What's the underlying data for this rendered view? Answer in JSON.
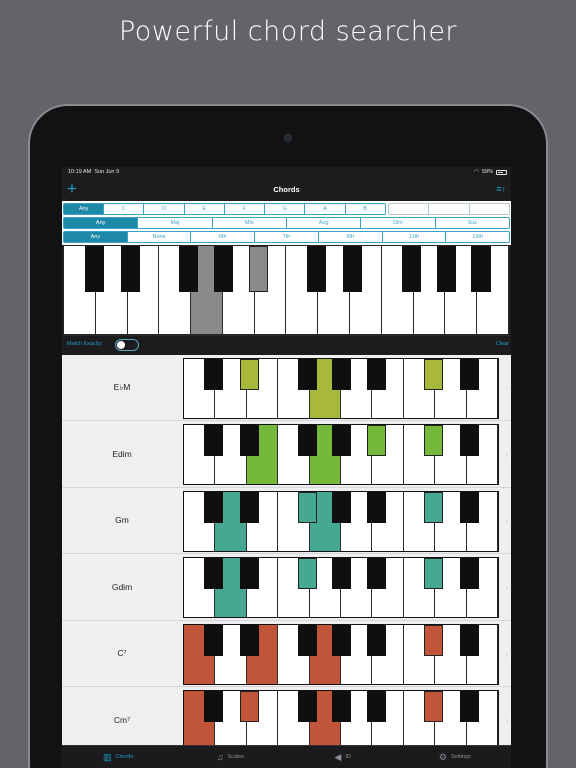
{
  "headline": "Powerful chord searcher",
  "status": {
    "time": "10:19 AM",
    "date": "Sun Jun 9",
    "battery": "59%"
  },
  "nav": {
    "title": "Chords",
    "add_icon": "plus-icon",
    "sort_icon": "sort-icon"
  },
  "filters": {
    "roots": [
      "Any",
      "C",
      "D",
      "E",
      "F",
      "G",
      "A",
      "B"
    ],
    "accidentals": [
      "",
      "",
      ""
    ],
    "qualities": [
      "Any",
      "Maj",
      "Min",
      "Aug",
      "Dim",
      "Sus"
    ],
    "extensions": [
      "Any",
      "None",
      "6th",
      "7th",
      "9th",
      "11th",
      "13th"
    ]
  },
  "match": {
    "label": "Match Exactly:",
    "clear": "Clear"
  },
  "colors": {
    "accent": "#1e9fc7",
    "olive": "#a8b83a",
    "green": "#76b83a",
    "teal": "#46a893",
    "red": "#c0553a",
    "gray": "#8a8a8a"
  },
  "chords": [
    {
      "name": "E♭M",
      "sup": "",
      "color": "#a8b83a"
    },
    {
      "name": "Edim",
      "sup": "",
      "color": "#76b83a"
    },
    {
      "name": "Gm",
      "sup": "",
      "color": "#46a893"
    },
    {
      "name": "Gdim",
      "sup": "",
      "color": "#46a893"
    },
    {
      "name": "C",
      "sup": "7",
      "color": "#c0553a"
    },
    {
      "name": "Cm",
      "sup": "7",
      "color": "#c0553a"
    }
  ],
  "tabs": [
    {
      "label": "Chords",
      "icon": "piano-icon"
    },
    {
      "label": "Scales",
      "icon": "scales-icon"
    },
    {
      "label": "ID",
      "icon": "speaker-icon"
    },
    {
      "label": "Settings",
      "icon": "gear-icon"
    }
  ]
}
